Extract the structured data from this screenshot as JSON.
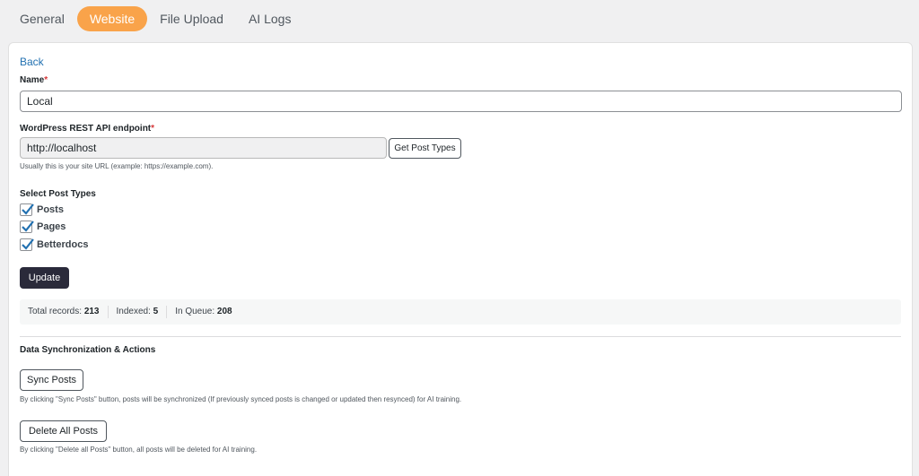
{
  "tabs": [
    {
      "label": "General",
      "active": false
    },
    {
      "label": "Website",
      "active": true
    },
    {
      "label": "File Upload",
      "active": false
    },
    {
      "label": "AI Logs",
      "active": false
    }
  ],
  "form": {
    "back_label": "Back",
    "name_label": "Name",
    "required_mark": "*",
    "name_value": "Local",
    "endpoint_label": "WordPress REST API endpoint",
    "endpoint_value": "http://localhost",
    "get_post_types_label": "Get Post Types",
    "endpoint_help": "Usually this is your site URL (example: https://example.com).",
    "post_types_label": "Select Post Types",
    "post_types": [
      {
        "label": "Posts",
        "checked": true
      },
      {
        "label": "Pages",
        "checked": true
      },
      {
        "label": "Betterdocs",
        "checked": true
      }
    ],
    "update_label": "Update"
  },
  "stats": {
    "total_label": "Total records:",
    "total_value": "213",
    "indexed_label": "Indexed:",
    "indexed_value": "5",
    "queue_label": "In Queue:",
    "queue_value": "208"
  },
  "sync": {
    "section_title": "Data Synchronization & Actions",
    "sync_label": "Sync Posts",
    "sync_help": "By clicking \"Sync Posts\" button, posts will be synchronized (If previously synced posts is changed or updated then resynced) for AI training.",
    "delete_label": "Delete All Posts",
    "delete_help": "By clicking \"Delete all Posts\" button, all posts will be deleted for AI training."
  },
  "colors": {
    "accent": "#f9a34a",
    "link": "#2271b1",
    "dark_button": "#2a2a3a",
    "checkbox_check": "#2271b1"
  }
}
